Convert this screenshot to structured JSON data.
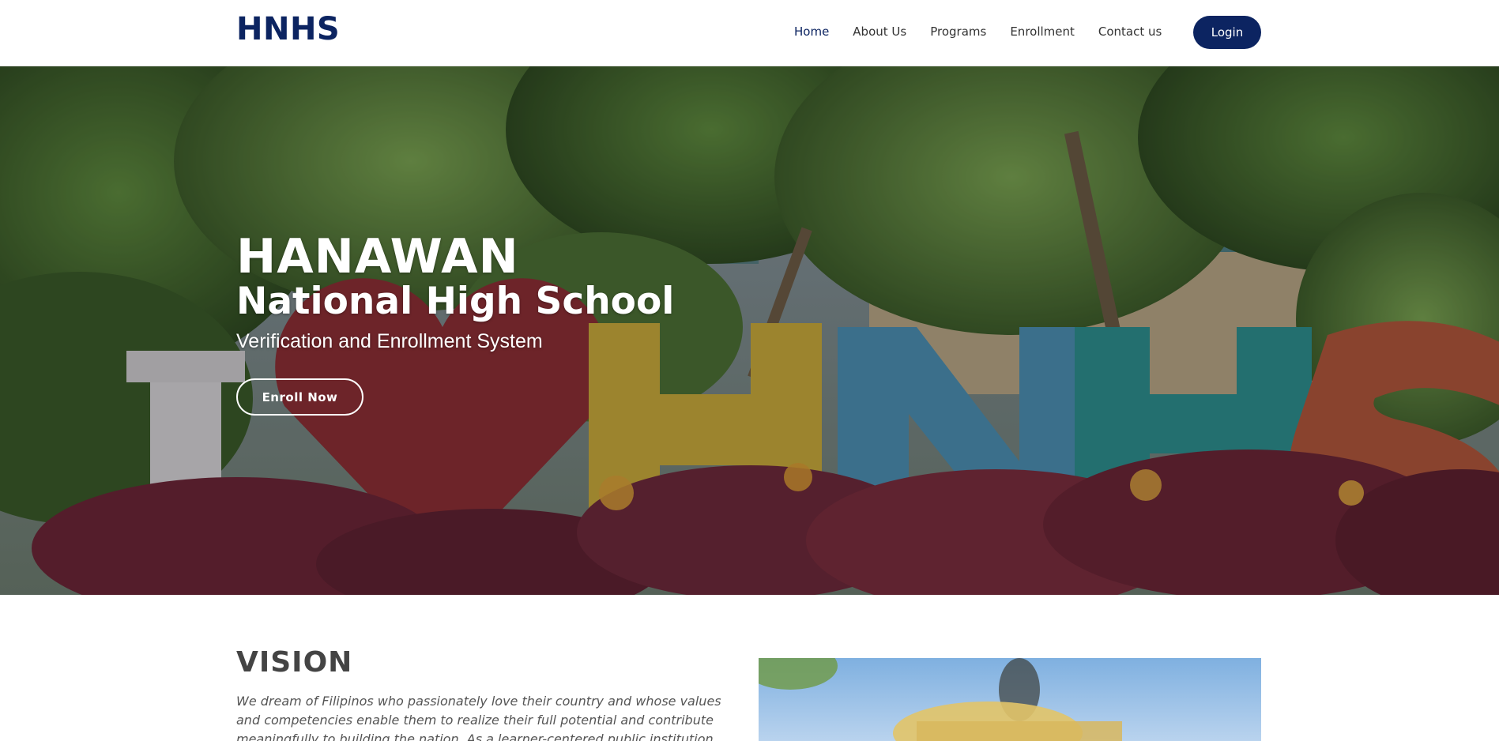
{
  "header": {
    "brand": "HNHS",
    "nav": [
      "Home",
      "About Us",
      "Programs",
      "Enrollment",
      "Contact us"
    ],
    "active_nav": "Home",
    "login_label": "Login"
  },
  "hero": {
    "title_line1": "HANAWAN",
    "title_line2": "National High School",
    "subtitle": "Verification and Enrollment System",
    "cta_label": "Enroll Now"
  },
  "vision": {
    "heading": "VISION",
    "text": "We dream of Filipinos who passionately love their country and whose values and competencies enable them to realize their full potential and contribute meaningfully to building the nation. As a learner-centered public institution, the Department of Education"
  },
  "colors": {
    "brand_navy": "#0c2461",
    "white": "#ffffff",
    "text_gray": "#555555"
  }
}
